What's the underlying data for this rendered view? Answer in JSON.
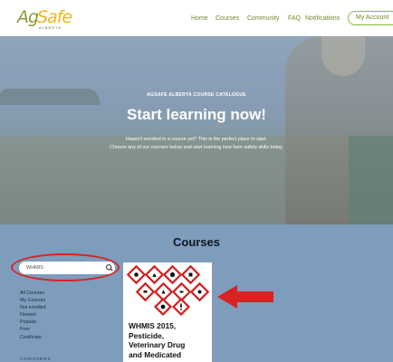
{
  "header": {
    "logo": {
      "ag": "Ag",
      "safe": "Safe",
      "sub": "ALBERTA"
    },
    "nav": [
      "Home",
      "Courses",
      "Community",
      "FAQ",
      "Notifications"
    ],
    "account": "My Account"
  },
  "hero": {
    "kicker": "AGSAFE ALBERTA COURSE CATALOGUE",
    "title": "Start learning now!",
    "line1": "Haven't enrolled in a course yet? This is the perfect place to start.",
    "line2": "Choose any of our courses below and start learning new farm safety skills today."
  },
  "catalog": {
    "heading": "Courses",
    "search_value": "WHMIS",
    "filters": [
      "All Courses",
      "My Courses",
      "Not enrolled",
      "Newest",
      "Popular",
      "Free",
      "Certificate"
    ],
    "categories_label": "CATEGORIES"
  },
  "course_card": {
    "title_lines": [
      "WHMIS 2015,",
      "Pesticide,",
      "Veterinary Drug",
      "and Medicated"
    ]
  },
  "colors": {
    "brand_green": "#8a9a36",
    "brand_yellow": "#f0b41c",
    "section_bg": "#7e9cbc",
    "highlight_red": "#d52525"
  },
  "icons": [
    "search-icon",
    "ghs-hazard-pictograms",
    "arrow-left-icon"
  ]
}
